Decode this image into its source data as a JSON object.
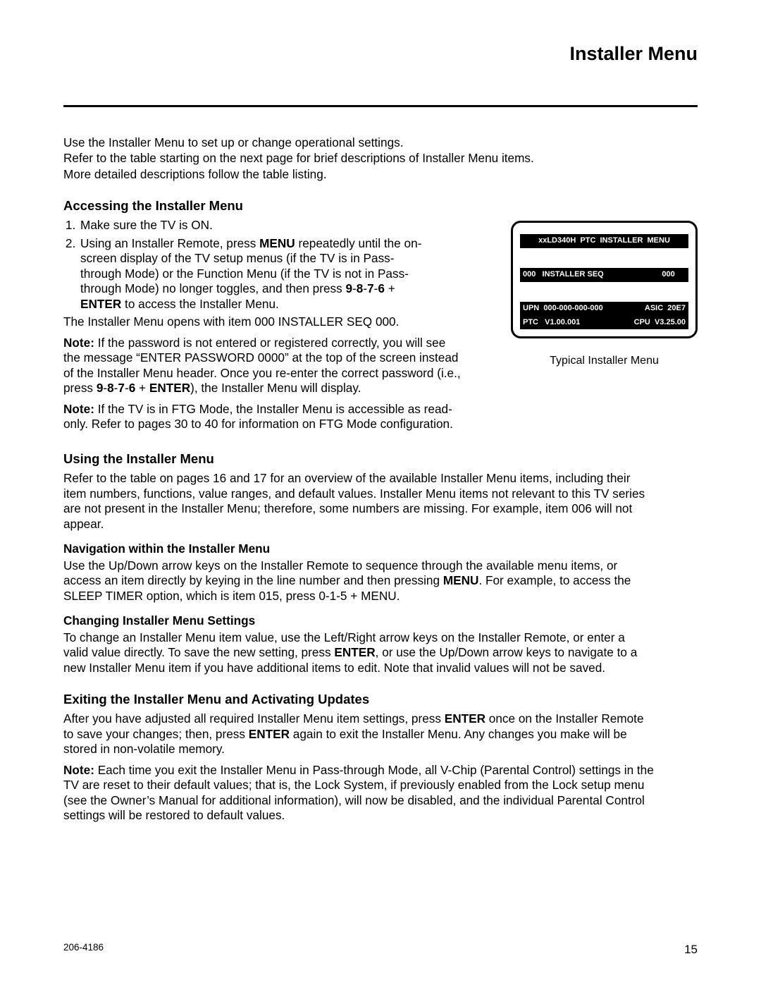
{
  "page_title": "Installer Menu",
  "intro": [
    "Use the Installer Menu to set up or change operational settings.",
    "Refer to the table starting on the next page for brief descriptions of Installer Menu items.",
    "More detailed descriptions follow the table listing."
  ],
  "accessing": {
    "heading": "Accessing the Installer Menu",
    "items": [
      {
        "pre": "Make sure the TV is ON."
      },
      {
        "pre": "Using an Installer Remote, press ",
        "b1": "MENU",
        "mid": " repeatedly until the on-screen display of the TV setup menus (if the TV is in Pass-through Mode) or the Function Menu (if the TV is not in Pass-through Mode) no longer toggles, and then press ",
        "b2": "9",
        "d1": "-",
        "b3": "8",
        "d2": "-",
        "b4": "7",
        "d3": "-",
        "b5": "6",
        "plus": " + ",
        "b6": "ENTER",
        "post": " to access the Installer Menu."
      }
    ],
    "p1": "The Installer Menu opens with item 000 INSTALLER SEQ 000.",
    "note1": {
      "label": "Note:",
      "pre": " If the password is not entered or registered correctly, you will see the message “ENTER PASSWORD 0000” at the top of the screen instead of the Installer Menu header. Once you re-enter the correct password (i.e., press ",
      "b1": "9",
      "d1": "-",
      "b2": "8",
      "d2": "-",
      "b3": "7",
      "d3": "-",
      "b4": "6",
      "plus": " + ",
      "b5": "ENTER",
      "post": "), the Installer Menu will display."
    },
    "note2": {
      "label": "Note:",
      "text": " If the TV is in FTG Mode, the Installer Menu is accessible as read-only. Refer to pages 30 to 40 for information on FTG Mode configuration."
    }
  },
  "screen": {
    "title": "xxLD340H  PTC  INSTALLER  MENU",
    "seq_left": "000   INSTALLER SEQ",
    "seq_right": "000     ",
    "info1_left": "UPN  000-000-000-000",
    "info1_right": "ASIC  20E7",
    "info2_left": "PTC   V1.00.001",
    "info2_right": "CPU  V3.25.00",
    "caption": "Typical Installer Menu"
  },
  "using": {
    "heading": "Using the Installer Menu",
    "p1": "Refer to the table on pages 16 and 17 for an overview of the available Installer Menu items, including their item numbers, functions, value ranges, and default values. Installer Menu items not relevant to this TV series are not present in the Installer Menu; therefore, some numbers are missing. For example, item 006 will not appear.",
    "nav_heading": "Navigation within the Installer Menu",
    "nav": {
      "pre": "Use the Up/Down arrow keys on the Installer Remote to sequence through the available menu items, or access an item directly by keying in the line number and then pressing ",
      "b1": "MENU",
      "post": ". For example, to access the SLEEP TIMER option, which is item 015, press 0-1-5 + MENU."
    },
    "chg_heading": "Changing Installer Menu Settings",
    "chg": {
      "pre": "To change an Installer Menu item value, use the Left/Right arrow keys on the Installer Remote, or enter a valid value directly. To save the new setting, press ",
      "b1": "ENTER",
      "post": ", or use the Up/Down arrow keys to navigate to a new Installer Menu item if you have additional items to edit. Note that invalid values will not be saved."
    }
  },
  "exit": {
    "heading": "Exiting the Installer Menu and Activating Updates",
    "p1": {
      "pre": "After you have adjusted all required Installer Menu item settings, press ",
      "b1": "ENTER",
      "mid": " once on the Installer Remote to save your changes; then, press ",
      "b2": "ENTER",
      "post": " again to exit the Installer Menu. Any changes you make will be stored in non-volatile memory."
    },
    "note": {
      "label": "Note:",
      "text": " Each time you exit the Installer Menu in Pass-through Mode, all V-Chip (Parental Control) settings in the TV are reset to their default values; that is, the Lock System, if previously enabled from the Lock setup menu (see the Owner’s Manual for additional information), will now be disabled, and the individual Parental Control settings will be restored to default values."
    }
  },
  "footer": {
    "doc": "206-4186",
    "page": "15"
  }
}
